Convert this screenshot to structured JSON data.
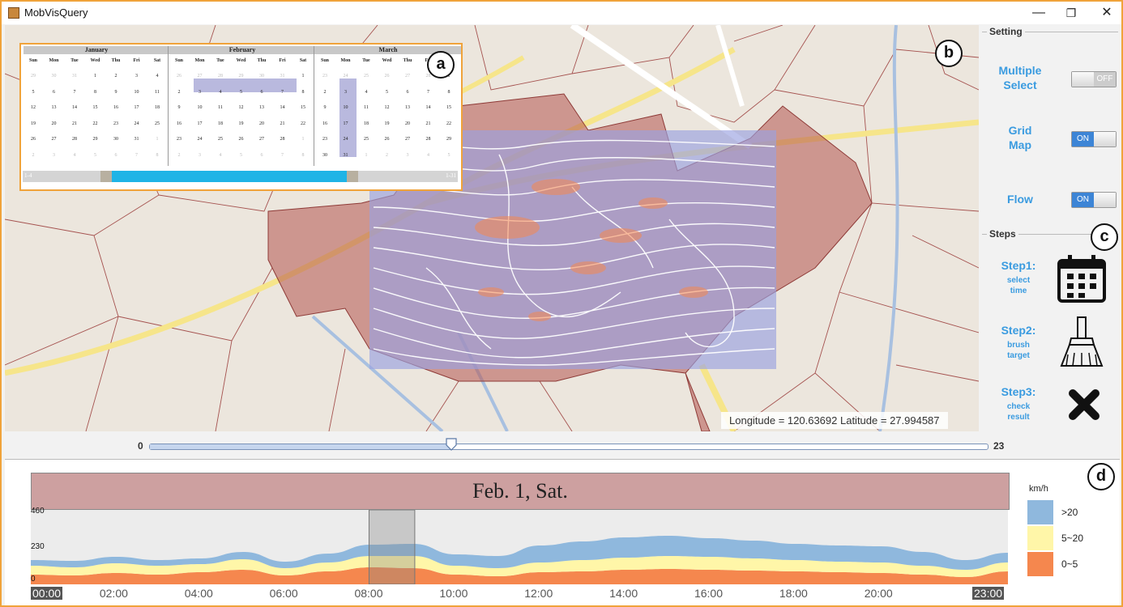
{
  "window": {
    "title": "MobVisQuery",
    "minimize_glyph": "—",
    "restore_glyph": "❐",
    "close_glyph": "✕"
  },
  "map": {
    "coordinate_readout": "Longitude = 120.63692 Latitude = 27.994587",
    "panel_labels": {
      "a": "a",
      "b": "b",
      "c": "c",
      "d": "d"
    }
  },
  "calendar": {
    "weekdays": [
      "Sun",
      "Mon",
      "Tue",
      "Wed",
      "Thu",
      "Fri",
      "Sat"
    ],
    "months": [
      {
        "name": "January",
        "days": [
          "29",
          "30",
          "31",
          "1",
          "2",
          "3",
          "4",
          "5",
          "6",
          "7",
          "8",
          "9",
          "10",
          "11",
          "12",
          "13",
          "14",
          "15",
          "16",
          "17",
          "18",
          "19",
          "20",
          "21",
          "22",
          "23",
          "24",
          "25",
          "26",
          "27",
          "28",
          "29",
          "30",
          "31",
          "1",
          "2",
          "3",
          "4",
          "5",
          "6",
          "7",
          "8"
        ],
        "muted_leading": 3,
        "muted_trailing": 8
      },
      {
        "name": "February",
        "days": [
          "26",
          "27",
          "28",
          "29",
          "30",
          "31",
          "1",
          "2",
          "3",
          "4",
          "5",
          "6",
          "7",
          "8",
          "9",
          "10",
          "11",
          "12",
          "13",
          "14",
          "15",
          "16",
          "17",
          "18",
          "19",
          "20",
          "21",
          "22",
          "23",
          "24",
          "25",
          "26",
          "27",
          "28",
          "1",
          "2",
          "3",
          "4",
          "5",
          "6",
          "7",
          "8"
        ],
        "muted_leading": 6,
        "muted_trailing": 8
      },
      {
        "name": "March",
        "days": [
          "23",
          "24",
          "25",
          "26",
          "27",
          "28",
          "1",
          "2",
          "3",
          "4",
          "5",
          "6",
          "7",
          "8",
          "9",
          "10",
          "11",
          "12",
          "13",
          "14",
          "15",
          "16",
          "17",
          "18",
          "19",
          "20",
          "21",
          "22",
          "23",
          "24",
          "25",
          "26",
          "27",
          "28",
          "29",
          "30",
          "31",
          "1",
          "2",
          "3",
          "4",
          "5"
        ],
        "muted_leading": 6,
        "muted_trailing": 5
      }
    ],
    "range_start_label": "1-4",
    "range_end_label": "1-31"
  },
  "settings": {
    "group_title": "Setting",
    "items": [
      {
        "label_line1": "Multiple",
        "label_line2": "Select",
        "state": "OFF"
      },
      {
        "label_line1": "Grid",
        "label_line2": "Map",
        "state": "ON"
      },
      {
        "label_line1": "Flow",
        "label_line2": "",
        "state": "ON"
      }
    ]
  },
  "steps": {
    "group_title": "Steps",
    "items": [
      {
        "title": "Step1:",
        "sub1": "select",
        "sub2": "time",
        "icon": "calendar-icon"
      },
      {
        "title": "Step2:",
        "sub1": "brush",
        "sub2": "target",
        "icon": "brush-icon"
      },
      {
        "title": "Step3:",
        "sub1": "check",
        "sub2": "result",
        "icon": "x-mark-icon"
      }
    ]
  },
  "hour_slider": {
    "min_label": "0",
    "max_label": "23",
    "value": 8
  },
  "timeline": {
    "date_label": "Feb. 1, Sat.",
    "y_ticks": [
      "460",
      "230",
      "0"
    ],
    "x_ticks": [
      "00:00",
      "02:00",
      "04:00",
      "06:00",
      "08:00",
      "10:00",
      "12:00",
      "14:00",
      "16:00",
      "18:00",
      "20:00",
      "23:00"
    ],
    "legend_unit": "km/h",
    "legend": [
      {
        "label": ">20",
        "color": "#8fb8dd"
      },
      {
        "label": "5~20",
        "color": "#fff6a8"
      },
      {
        "label": "0~5",
        "color": "#f5874e"
      }
    ]
  },
  "colors": {
    "accent_border": "#f0a33a",
    "setting_text": "#3a9be0",
    "toggle_on": "#3d85d6",
    "voronoi_fill": "#b5534f",
    "flow_overlay": "#9aa2e0"
  },
  "chart_data": {
    "type": "area",
    "title": "Feb. 1, Sat.",
    "xlabel": "",
    "ylabel": "",
    "ylim": [
      0,
      460
    ],
    "x": [
      0,
      1,
      2,
      3,
      4,
      5,
      6,
      7,
      8,
      9,
      10,
      11,
      12,
      13,
      14,
      15,
      16,
      17,
      18,
      19,
      20,
      21,
      22,
      23
    ],
    "series": [
      {
        "name": "0~5",
        "values": [
          60,
          55,
          70,
          60,
          75,
          90,
          55,
          80,
          105,
          100,
          60,
          50,
          75,
          80,
          90,
          95,
          90,
          85,
          80,
          75,
          70,
          60,
          45,
          80
        ]
      },
      {
        "name": "5~20",
        "values": [
          55,
          50,
          60,
          55,
          50,
          65,
          45,
          55,
          70,
          75,
          55,
          50,
          60,
          70,
          75,
          80,
          80,
          75,
          70,
          65,
          65,
          55,
          45,
          55
        ]
      },
      {
        "name": ">20",
        "values": [
          35,
          40,
          40,
          35,
          35,
          45,
          40,
          55,
          70,
          75,
          70,
          75,
          105,
          115,
          125,
          125,
          115,
          110,
          100,
          100,
          100,
          85,
          60,
          60
        ]
      }
    ]
  }
}
